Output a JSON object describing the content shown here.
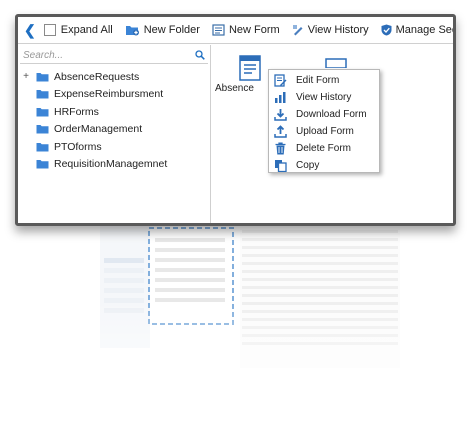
{
  "toolbar": {
    "expand_all_label": "Expand All",
    "new_folder_label": "New Folder",
    "new_form_label": "New Form",
    "view_history_label": "View History",
    "manage_security_label": "Manage Security"
  },
  "search": {
    "placeholder": "Search..."
  },
  "tree": {
    "items": [
      {
        "label": "AbsenceRequests",
        "expander": "+"
      },
      {
        "label": "ExpenseReimbursment",
        "expander": ""
      },
      {
        "label": "HRForms",
        "expander": ""
      },
      {
        "label": "OrderManagement",
        "expander": ""
      },
      {
        "label": "PTOforms",
        "expander": ""
      },
      {
        "label": "RequisitionManagemnet",
        "expander": ""
      }
    ]
  },
  "content": {
    "form_label": "Absence"
  },
  "context_menu": {
    "items": [
      {
        "label": "Edit Form",
        "icon": "edit-form-icon"
      },
      {
        "label": "View History",
        "icon": "history-icon"
      },
      {
        "label": "Download Form",
        "icon": "download-icon"
      },
      {
        "label": "Upload Form",
        "icon": "upload-icon"
      },
      {
        "label": "Delete Form",
        "icon": "trash-icon"
      },
      {
        "label": "Copy",
        "icon": "copy-icon"
      }
    ]
  },
  "colors": {
    "accent": "#1e6fc2",
    "folder": "#3b84d6",
    "frame": "#5a5a5a"
  }
}
